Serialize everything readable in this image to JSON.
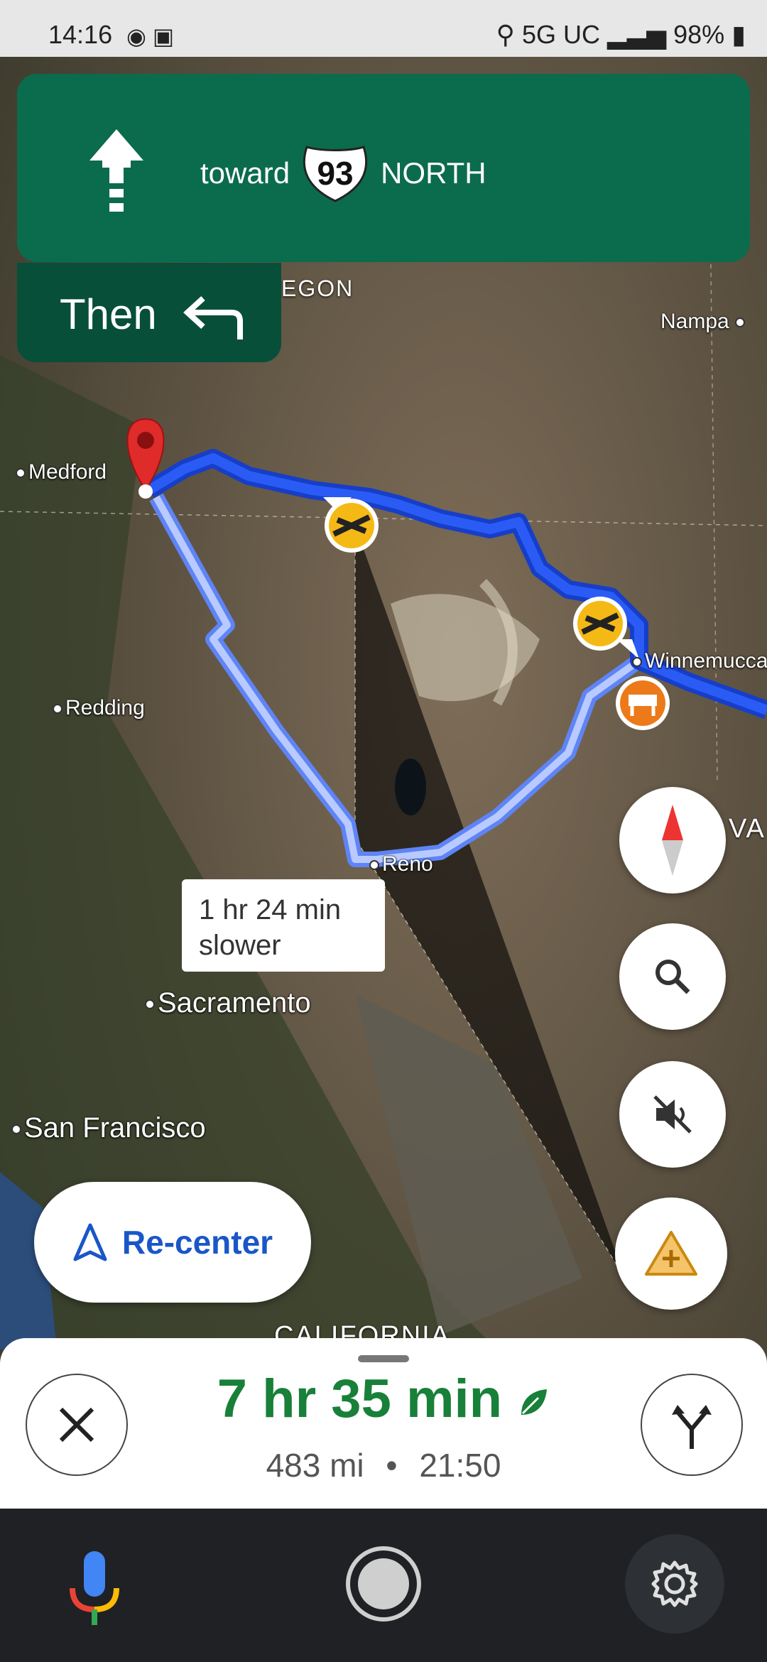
{
  "status_bar": {
    "time": "14:16",
    "indicators": "5G UC",
    "battery": "98%"
  },
  "instruction": {
    "prefix": "toward",
    "route_number": "93",
    "direction": "NORTH"
  },
  "then": {
    "label": "Then"
  },
  "map": {
    "cities": {
      "medford": "Medford",
      "redding": "Redding",
      "reno": "Reno",
      "sacramento": "Sacramento",
      "san_francisco": "San Francisco",
      "nampa": "Nampa",
      "winnemucca": "Winnemucca"
    },
    "regions": {
      "oregon": "EGON",
      "california": "CALIFORNIA",
      "nevada": "VA"
    },
    "alt_route_label": {
      "line1": "1 hr 24 min",
      "line2": "slower"
    }
  },
  "buttons": {
    "recenter": "Re-center"
  },
  "trip": {
    "hours": "7",
    "hr_unit": "hr",
    "minutes": "35",
    "min_unit": "min",
    "distance": "483 mi",
    "separator": "•",
    "arrival": "21:50"
  },
  "colors": {
    "banner": "#0b6b4d",
    "then": "#074f39",
    "route": "#1a4fe0",
    "alt_route": "#9db6ff",
    "eta": "#188038"
  }
}
